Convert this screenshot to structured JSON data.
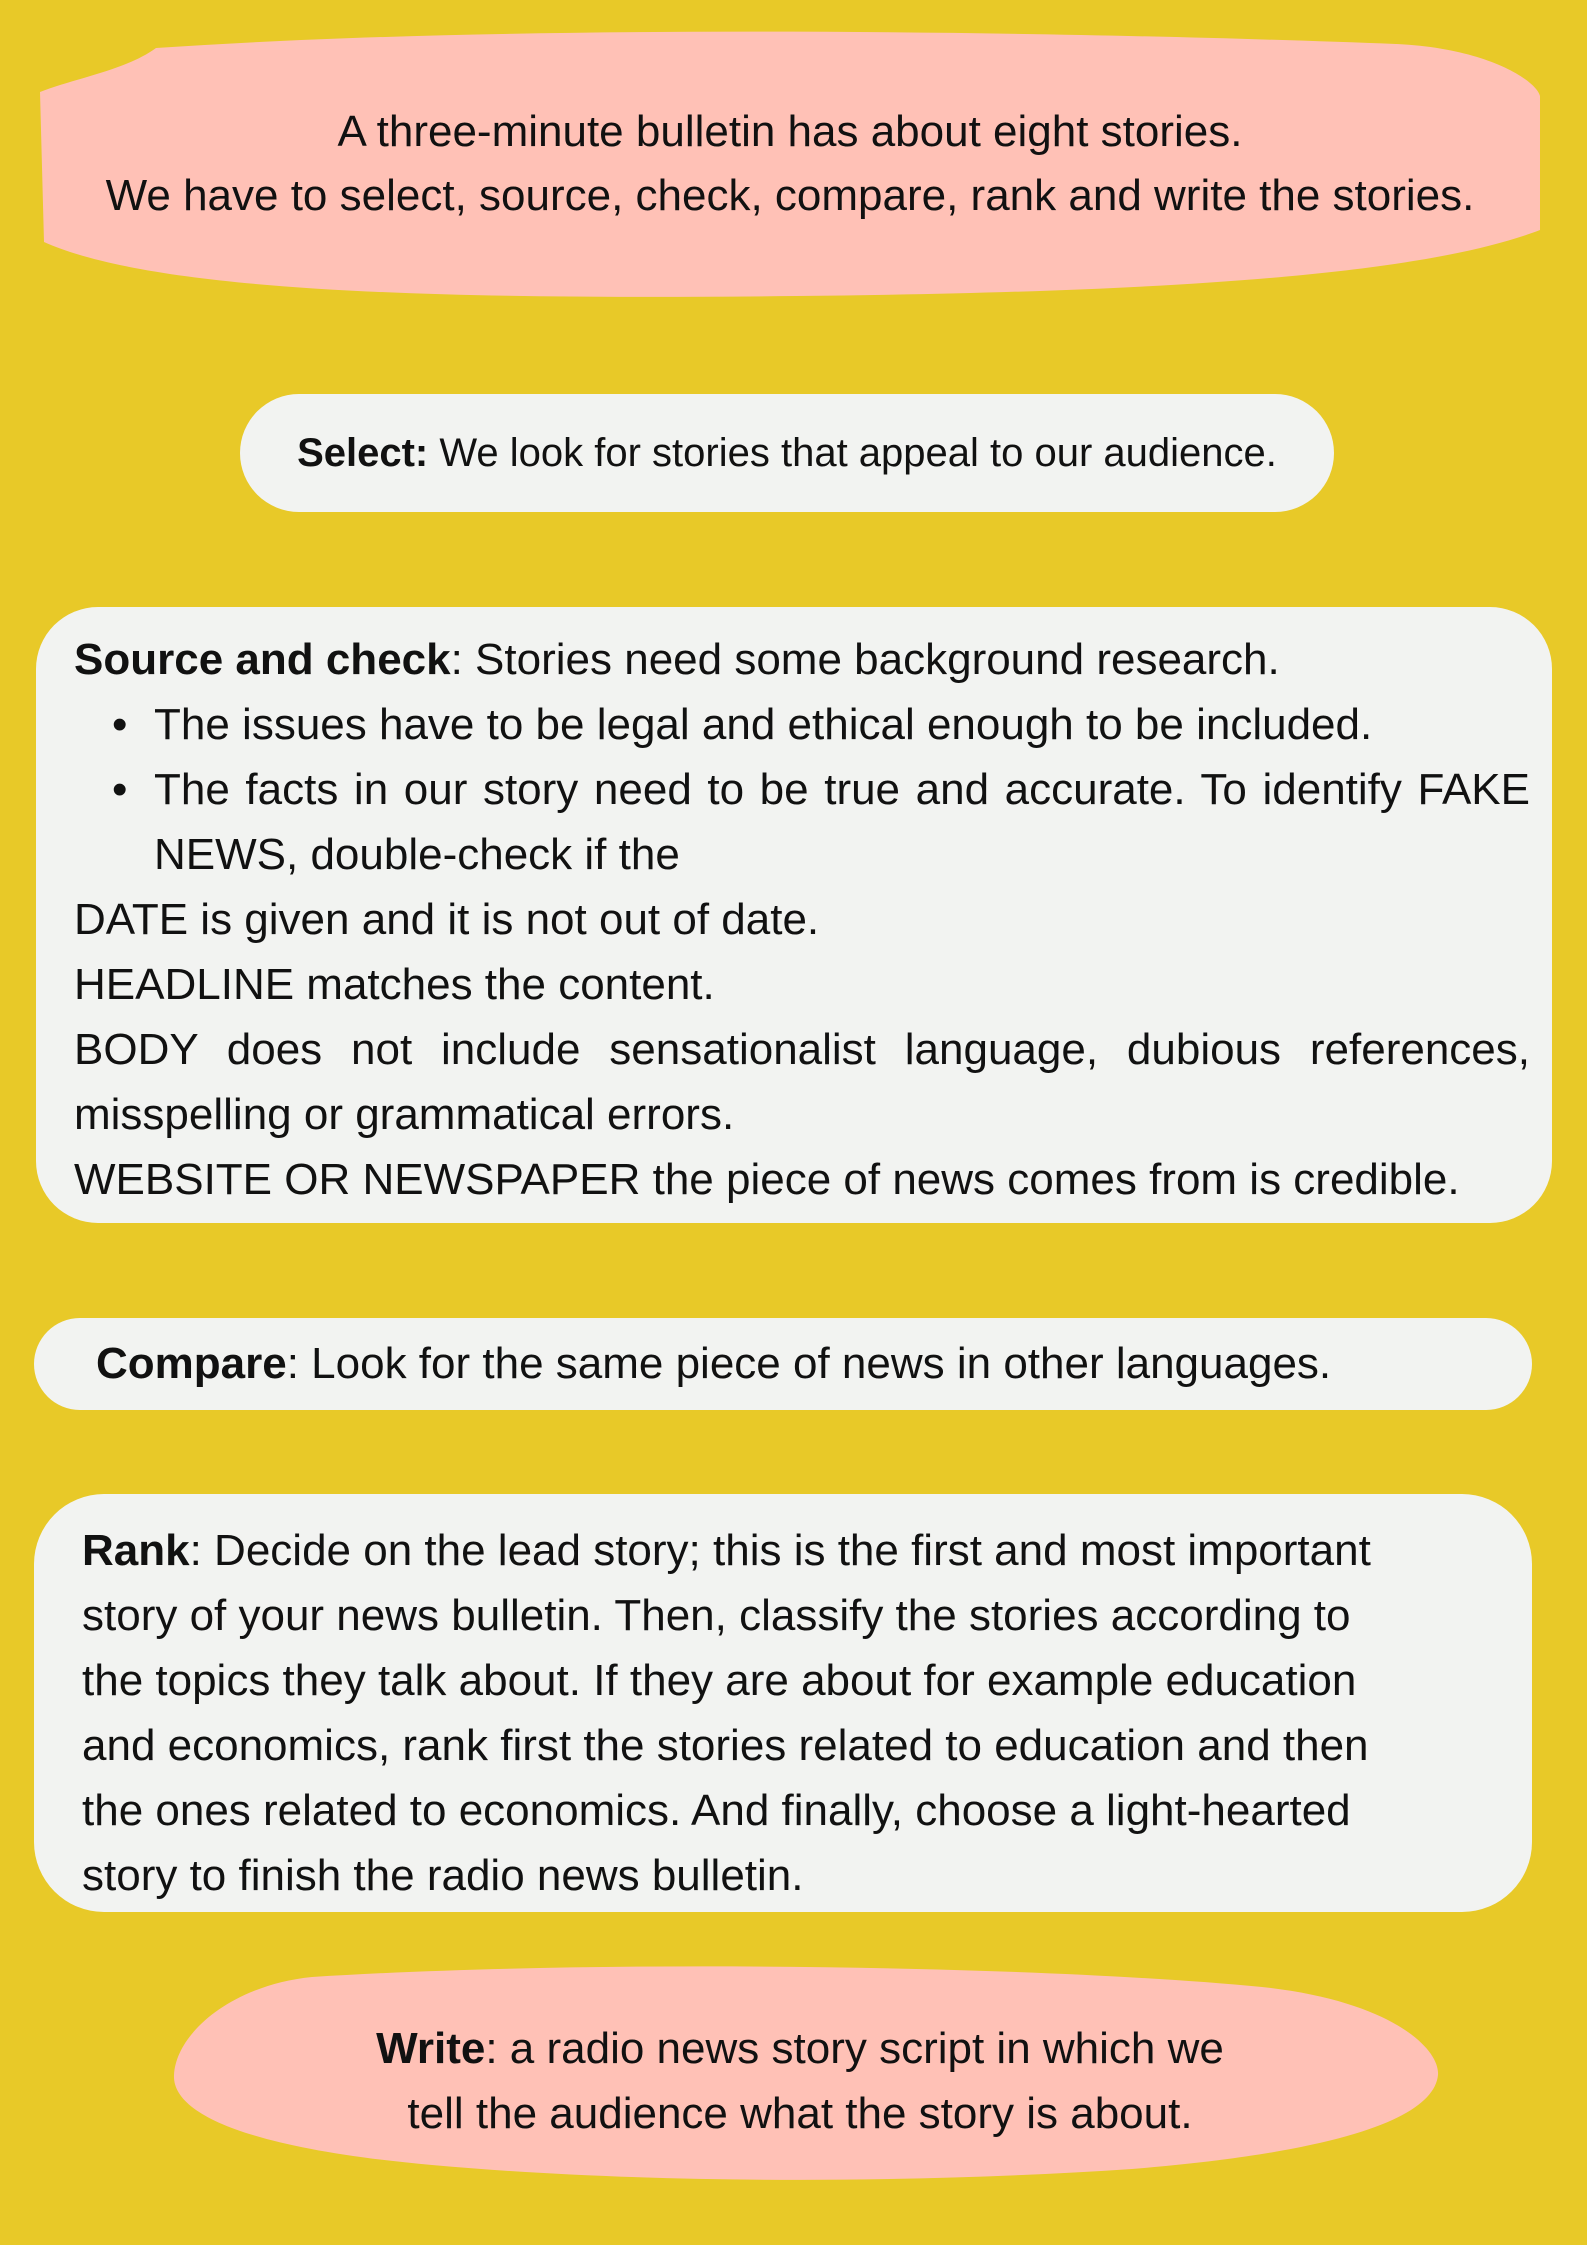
{
  "intro": {
    "line1": "A three-minute bulletin has about eight stories.",
    "line2": "We have to select, source, check, compare, rank and write the stories."
  },
  "select": {
    "heading": "Select:",
    "text": " We look for stories that appeal to our audience."
  },
  "source_check": {
    "heading": "Source and check",
    "text": ": Stories need some background research.",
    "bullets": [
      "The issues have to be legal and ethical enough to be included.",
      "The facts in our story need to be true and accurate. To identify FAKE NEWS, double-check if the"
    ],
    "checks": [
      "DATE is given and it is not out of date.",
      "HEADLINE matches the content.",
      "BODY does not include sensationalist language, dubious references, misspelling or grammatical errors.",
      "WEBSITE OR NEWSPAPER the piece of news comes from is credible."
    ]
  },
  "compare": {
    "heading": "Compare",
    "text": ": Look for the same piece of news in other languages."
  },
  "rank": {
    "heading": "Rank",
    "lines": [
      ": Decide on the lead story; this is the first and most important",
      "story of your news bulletin. Then, classify the stories according to",
      "the topics they talk about. If they are about for example education",
      "and economics, rank first the stories related to education and then",
      "the ones related to economics. And finally, choose a light-hearted",
      "story to finish the radio news bulletin."
    ]
  },
  "write": {
    "heading": "Write",
    "line1": ": a radio news story script in which we",
    "line2": "tell the audience what the story is about."
  },
  "colors": {
    "background": "#e8c928",
    "pink_blob": "#ffc1b6",
    "white_box": "#f2f3f1",
    "text": "#111111"
  }
}
